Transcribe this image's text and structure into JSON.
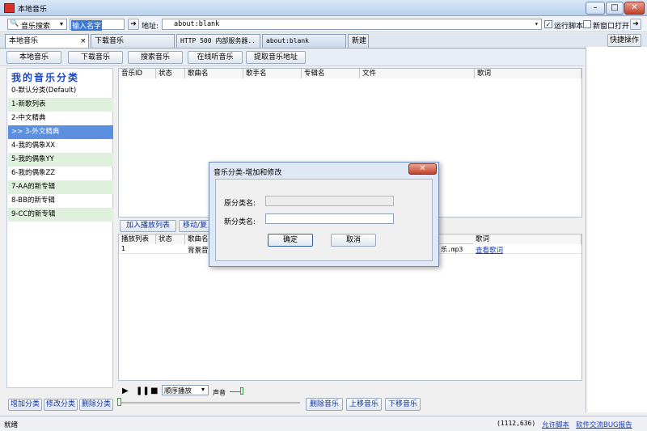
{
  "window": {
    "title": "本地音乐",
    "controls": {
      "minimize": "–",
      "maximize": "□",
      "close": "✕"
    }
  },
  "toolbar": {
    "search_type": "音乐搜索",
    "search_value": "输入名字",
    "address_label": "地址:",
    "address_value": "about:blank",
    "run_script_label": "运行脚本",
    "run_script_checked": true,
    "new_window_label": "新窗口打开",
    "new_window_checked": false
  },
  "tabs": [
    {
      "label": "本地音乐",
      "active": true
    },
    {
      "label": "下载音乐"
    },
    {
      "label": "HTTP 500 内部服务器.."
    },
    {
      "label": "about:blank"
    }
  ],
  "tab_close": "×",
  "new_tab_label": "新建",
  "quick_action_label": "快捷操作",
  "nav_buttons": [
    "本地音乐",
    "下载音乐",
    "搜索音乐",
    "在线听音乐",
    "提取音乐地址"
  ],
  "sidebar": {
    "title": "我的音乐分类",
    "categories": [
      "0-默认分类(Default)",
      "1-新歌列表",
      "2-中文精典",
      ">> 3-外文精典",
      "4-我的偶象XX",
      "5-我的偶象YY",
      "6-我的偶象ZZ",
      "7-AA的新专辑",
      "8-BB的新专辑",
      "9-CC的新专辑"
    ],
    "selected_index": 3
  },
  "music_table": {
    "headers": [
      "音乐ID",
      "状态",
      "歌曲名",
      "歌手名",
      "专辑名",
      "文件",
      "歌词"
    ]
  },
  "mid_buttons": [
    "加入播放列表",
    "移动/复"
  ],
  "playlist_table": {
    "headers": [
      "播放列表",
      "状态",
      "歌曲名",
      "歌词"
    ],
    "row": {
      "index": "1",
      "song_fragment": "背景音",
      "file_fragment": "乐.mp3",
      "lyrics_link": "查看歌词"
    }
  },
  "player": {
    "play_mode": "顺序播放",
    "volume_label": "声音"
  },
  "bottom_left_buttons": [
    "增加分类",
    "修改分类",
    "删除分类"
  ],
  "bottom_right_buttons": [
    "删除音乐",
    "上移音乐",
    "下移音乐"
  ],
  "dialog": {
    "title": "音乐分类-增加和修改",
    "original_label": "原分类名:",
    "original_value": "",
    "new_label": "新分类名:",
    "new_value": "",
    "ok_label": "确定",
    "cancel_label": "取消"
  },
  "status": {
    "text": "就绪",
    "coords": "(1112,636)",
    "link1": "允许脚本",
    "link2": "软件交流BUG报告"
  }
}
